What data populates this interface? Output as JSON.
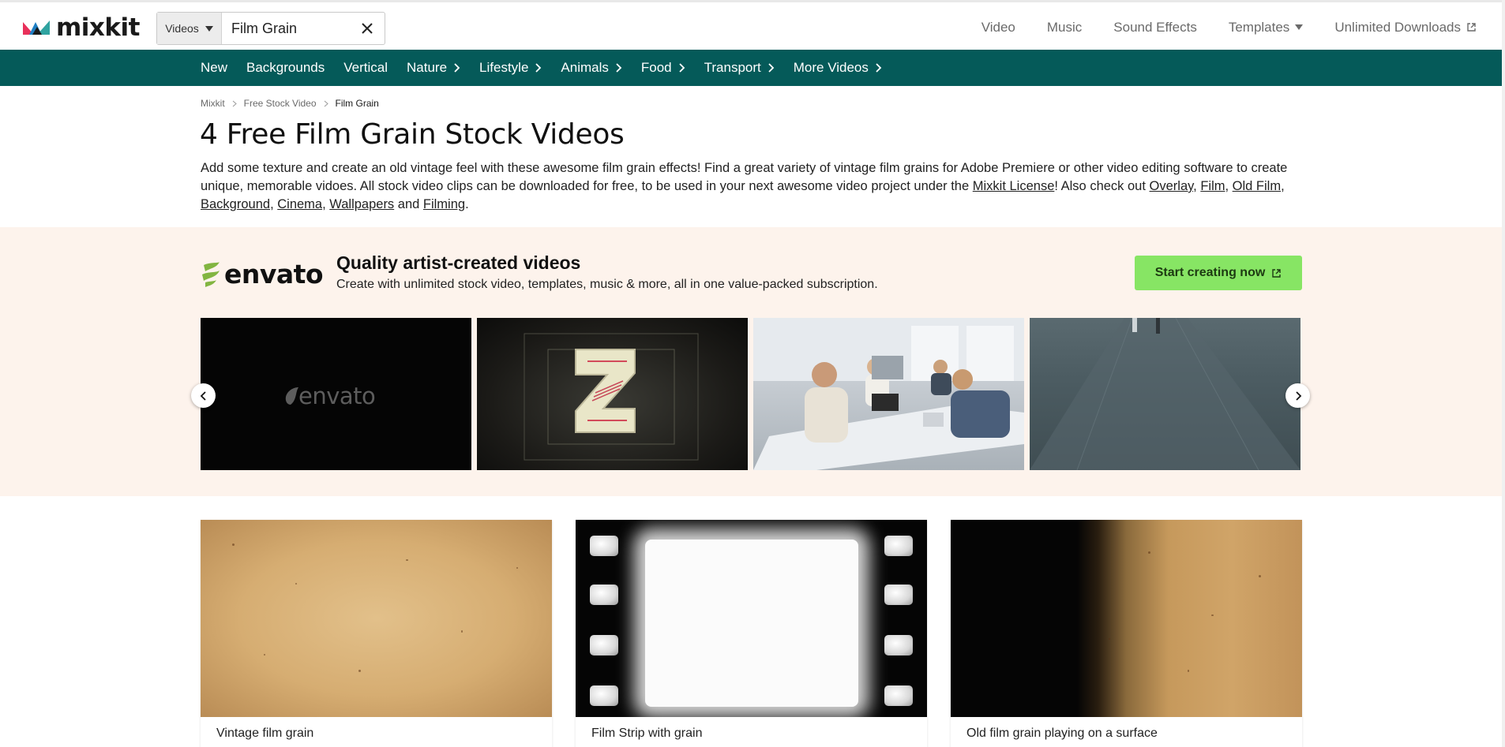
{
  "header": {
    "logo_text": "mixkit",
    "search": {
      "category": "Videos",
      "value": "Film Grain",
      "placeholder": "Search"
    },
    "nav": [
      {
        "label": "Video"
      },
      {
        "label": "Music"
      },
      {
        "label": "Sound Effects"
      },
      {
        "label": "Templates"
      },
      {
        "label": "Unlimited Downloads"
      }
    ]
  },
  "categories": [
    {
      "label": "New"
    },
    {
      "label": "Backgrounds"
    },
    {
      "label": "Vertical"
    },
    {
      "label": "Nature"
    },
    {
      "label": "Lifestyle"
    },
    {
      "label": "Animals"
    },
    {
      "label": "Food"
    },
    {
      "label": "Transport"
    },
    {
      "label": "More Videos"
    }
  ],
  "breadcrumb": [
    "Mixkit",
    "Free Stock Video",
    "Film Grain"
  ],
  "page": {
    "title": "4 Free Film Grain Stock Videos",
    "intro_part1": "Add some texture and create an old vintage feel with these awesome film grain effects! Find a great variety of vintage film grains for Adobe Premiere or other video editing software to create unique, memorable vidoes. All stock video clips can be downloaded for free, to be used in your next awesome video project under the ",
    "license_link": "Mixkit License",
    "intro_part2": "! Also check out ",
    "related": [
      "Overlay",
      "Film",
      "Old Film",
      "Background",
      "Cinema",
      "Wallpapers",
      "Filming"
    ],
    "sep_comma": ", ",
    "sep_and": " and ",
    "end_period": "."
  },
  "promo": {
    "brand": "envato",
    "title": "Quality artist-created videos",
    "subtitle": "Create with unlimited stock video, templates, music & more, all in one value-packed subscription.",
    "button": "Start creating now",
    "slide1_watermark": "envato",
    "accent_color": "#87e564",
    "background_color": "#fdf3ec"
  },
  "videos": [
    {
      "title": "Vintage film grain"
    },
    {
      "title": "Film Strip with grain"
    },
    {
      "title": "Old film grain playing on a surface"
    }
  ],
  "colors": {
    "category_bar": "#055a59",
    "active_nav_underline": "#8ed05a"
  }
}
